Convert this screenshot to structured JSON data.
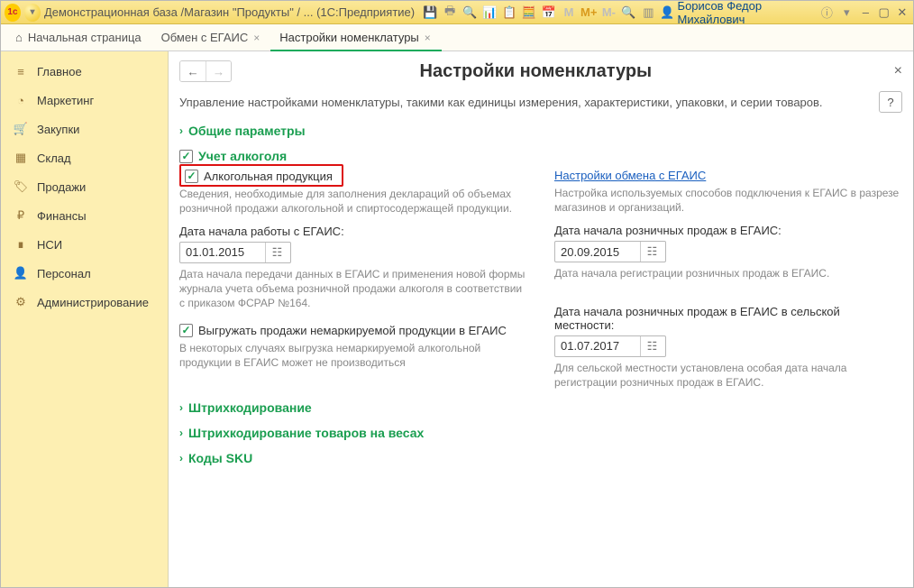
{
  "window": {
    "title": "Демонстрационная база /Магазин \"Продукты\" / ... (1С:Предприятие)",
    "user": "Борисов Федор Михайлович"
  },
  "tabs": {
    "home": "Начальная страница",
    "t1": "Обмен с ЕГАИС",
    "t2": "Настройки номенклатуры"
  },
  "sidebar": {
    "items": [
      {
        "label": "Главное"
      },
      {
        "label": "Маркетинг"
      },
      {
        "label": "Закупки"
      },
      {
        "label": "Склад"
      },
      {
        "label": "Продажи"
      },
      {
        "label": "Финансы"
      },
      {
        "label": "НСИ"
      },
      {
        "label": "Персонал"
      },
      {
        "label": "Администрирование"
      }
    ]
  },
  "page": {
    "title": "Настройки номенклатуры",
    "description": "Управление настройками номенклатуры, такими как единицы измерения, характеристики, упаковки, и серии товаров.",
    "help": "?",
    "exp_common": "Общие параметры",
    "section_alco_title": "Учет алкоголя",
    "checkbox_alco": "Алкогольная продукция",
    "alco_hint": "Сведения, необходимые для заполнения деклараций об объемах розничной продажи алкогольной и спиртосодержащей продукции.",
    "link_egais": "Настройки обмена с ЕГАИС",
    "link_egais_hint": "Настройка используемых способов подключения к ЕГАИС в разрезе магазинов и организаций.",
    "date1_label": "Дата начала работы с ЕГАИС:",
    "date1_value": "01.01.2015",
    "date1_hint": "Дата начала передачи данных в ЕГАИС и применения новой формы журнала учета объема розничной продажи алкоголя в соответствии с приказом ФСРАР №164.",
    "date2_label": "Дата начала розничных продаж в ЕГАИС:",
    "date2_value": "20.09.2015",
    "date2_hint": "Дата начала регистрации розничных продаж в ЕГАИС.",
    "checkbox_upload": "Выгружать продажи немаркируемой продукции в ЕГАИС",
    "upload_hint": "В некоторых случаях выгрузка немаркируемой алкогольной продукции в ЕГАИС может не производиться",
    "date3_label": "Дата начала розничных продаж в ЕГАИС в сельской местности:",
    "date3_value": "01.07.2017",
    "date3_hint": "Для сельской местности установлена особая дата начала регистрации розничных продаж в ЕГАИС.",
    "exp_barcode": "Штрихкодирование",
    "exp_scale": "Штрихкодирование товаров на весах",
    "exp_sku": "Коды SKU"
  }
}
